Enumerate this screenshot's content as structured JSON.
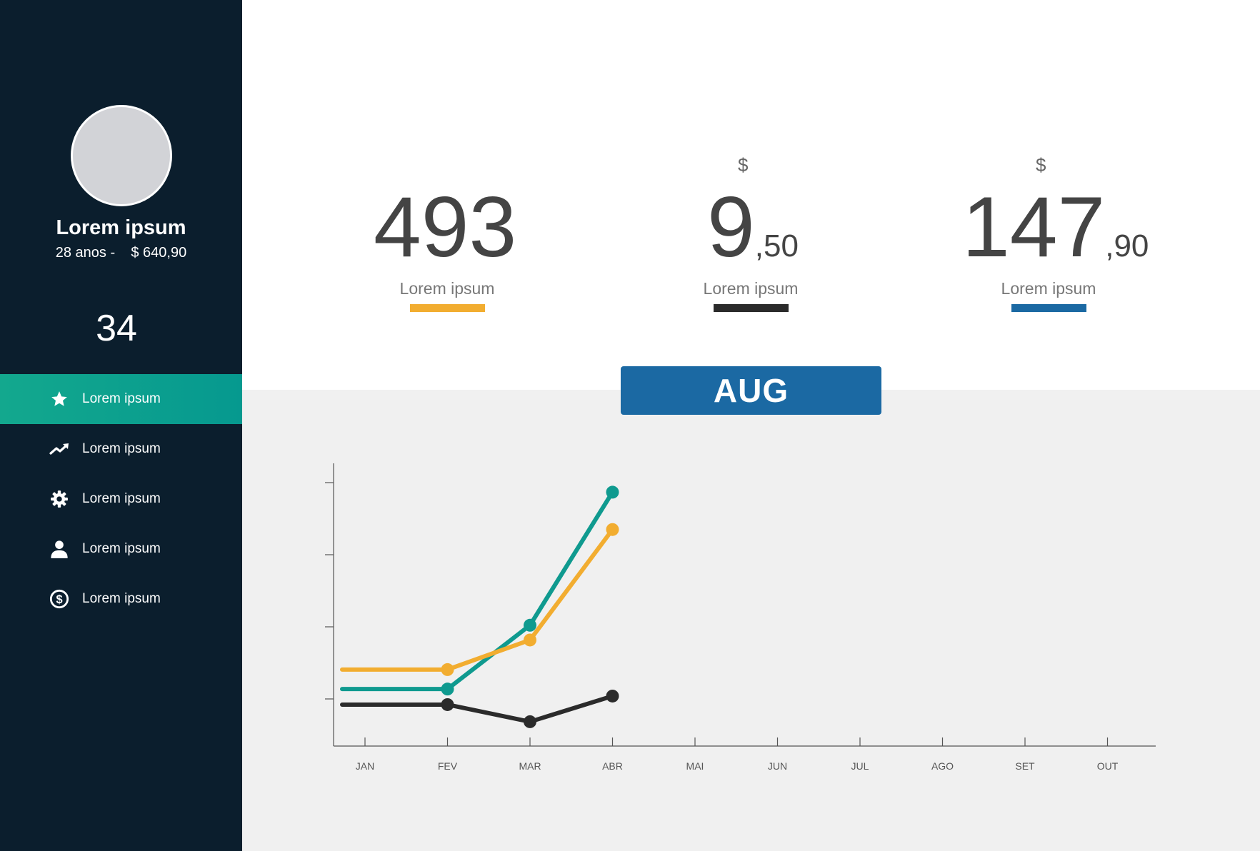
{
  "sidebar": {
    "profile": {
      "name": "Lorem ipsum",
      "age": "28 anos -",
      "balance": "$ 640,90",
      "count": "34"
    },
    "items": [
      {
        "label": "Lorem ipsum",
        "icon": "star-icon",
        "active": true
      },
      {
        "label": "Lorem ipsum",
        "icon": "trend-icon",
        "active": false
      },
      {
        "label": "Lorem ipsum",
        "icon": "gear-icon",
        "active": false
      },
      {
        "label": "Lorem ipsum",
        "icon": "user-icon",
        "active": false
      },
      {
        "label": "Lorem ipsum",
        "icon": "dollar-icon",
        "active": false
      }
    ]
  },
  "stats": [
    {
      "currency": "",
      "value": "493",
      "cents": "",
      "label": "Lorem ipsum",
      "color": "#f2ad30"
    },
    {
      "currency": "$",
      "value": "9",
      "cents": ",50",
      "label": "Lorem ipsum",
      "color": "#2b2b2b"
    },
    {
      "currency": "$",
      "value": "147",
      "cents": ",90",
      "label": "Lorem ipsum",
      "color": "#1b69a3"
    }
  ],
  "month_button": "AUG",
  "colors": {
    "sidebar_bg": "#0b1e2d",
    "active_item": "#06998f",
    "teal": "#0f9a8f",
    "orange": "#f2ad30",
    "dark": "#2b2b2b",
    "blue": "#1b69a3"
  },
  "chart_data": {
    "type": "line",
    "categories": [
      "JAN",
      "FEV",
      "MAR",
      "ABR",
      "MAI",
      "JUN",
      "JUL",
      "AGO",
      "SET",
      "OUT"
    ],
    "ylim": [
      0,
      4
    ],
    "grid": false,
    "series": [
      {
        "color": "#0f9a8f",
        "values": [
          0.65,
          0.65,
          1.47,
          3.18
        ]
      },
      {
        "color": "#f2ad30",
        "values": [
          0.9,
          0.9,
          1.28,
          2.7
        ]
      },
      {
        "color": "#2b2b2b",
        "values": [
          0.45,
          0.45,
          0.23,
          0.56
        ]
      }
    ]
  }
}
